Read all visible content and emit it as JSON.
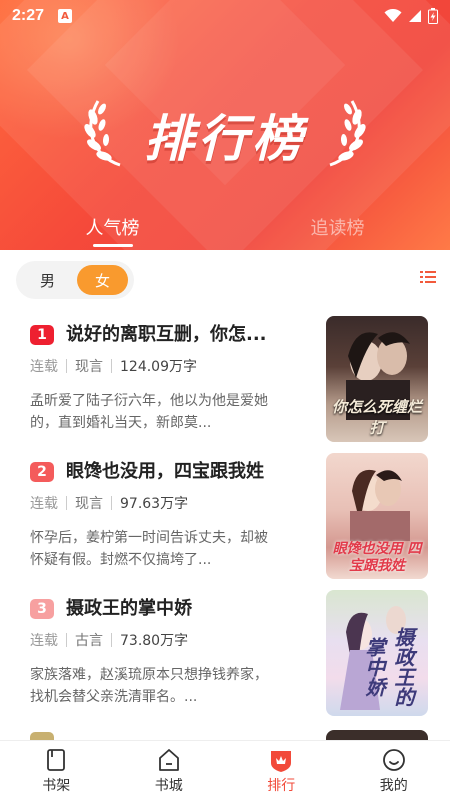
{
  "status_bar": {
    "time": "2:27",
    "badge": "A"
  },
  "header": {
    "title": "排行榜"
  },
  "tabs": [
    {
      "label": "人气榜",
      "active": true
    },
    {
      "label": "追读榜",
      "active": false
    }
  ],
  "gender": {
    "male": "男",
    "female": "女",
    "selected": "女"
  },
  "books": [
    {
      "rank": "1",
      "rank_color": "#ee2030",
      "title": "说好的离职互删，你怎...",
      "status": "连载",
      "genre": "现言",
      "word_count": "124.09万字",
      "desc": "孟昕爱了陆子衍六年，他以为他是爱她的，直到婚礼当天，新郎莫...",
      "cover_title": "你怎么死缠烂打"
    },
    {
      "rank": "2",
      "rank_color": "#f45b5b",
      "title": "眼馋也没用，四宝跟我姓",
      "status": "连载",
      "genre": "现言",
      "word_count": "97.63万字",
      "desc": "怀孕后，姜柠第一时间告诉丈夫，却被怀疑有假。封燃不仅搞垮了...",
      "cover_title": "眼馋也没用 四宝跟我姓"
    },
    {
      "rank": "3",
      "rank_color": "#f7a0a0",
      "title": "摄政王的掌中娇",
      "status": "连载",
      "genre": "古言",
      "word_count": "73.80万字",
      "desc": "家族落难，赵溪琉原本只想挣钱养家，找机会替父亲洗清罪名。...",
      "cover_title": "摄政王的掌中娇"
    }
  ],
  "bottom_nav": [
    {
      "label": "书架",
      "icon": "bookshelf-icon",
      "active": false
    },
    {
      "label": "书城",
      "icon": "bookstore-icon",
      "active": false
    },
    {
      "label": "排行",
      "icon": "ranking-icon",
      "active": true
    },
    {
      "label": "我的",
      "icon": "profile-icon",
      "active": false
    }
  ],
  "colors": {
    "accent": "#f24a3a",
    "toggle": "#f99a2e"
  }
}
